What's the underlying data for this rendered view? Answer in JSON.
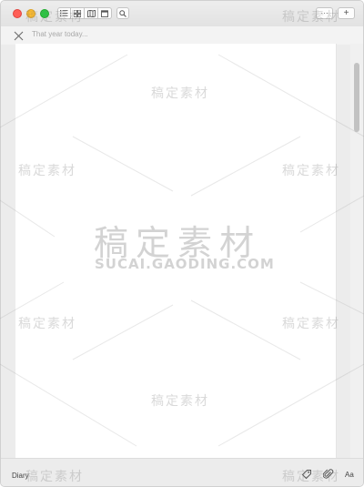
{
  "window": {
    "entry_title_placeholder": "That year today..."
  },
  "toolbar": {
    "view_buttons": [
      "list-icon",
      "grid-icon",
      "map-icon",
      "calendar-icon"
    ],
    "search_icon": "search-icon",
    "more_label": "···",
    "add_label": "+"
  },
  "footer": {
    "journal_name": "Diary",
    "font_label": "Aa"
  },
  "watermark": {
    "brand": "稿定素材",
    "url": "SUCAI.GAODING.COM"
  },
  "colors": {
    "close": "#ff5f57",
    "minimize": "#febc2e",
    "maximize": "#28c840"
  }
}
